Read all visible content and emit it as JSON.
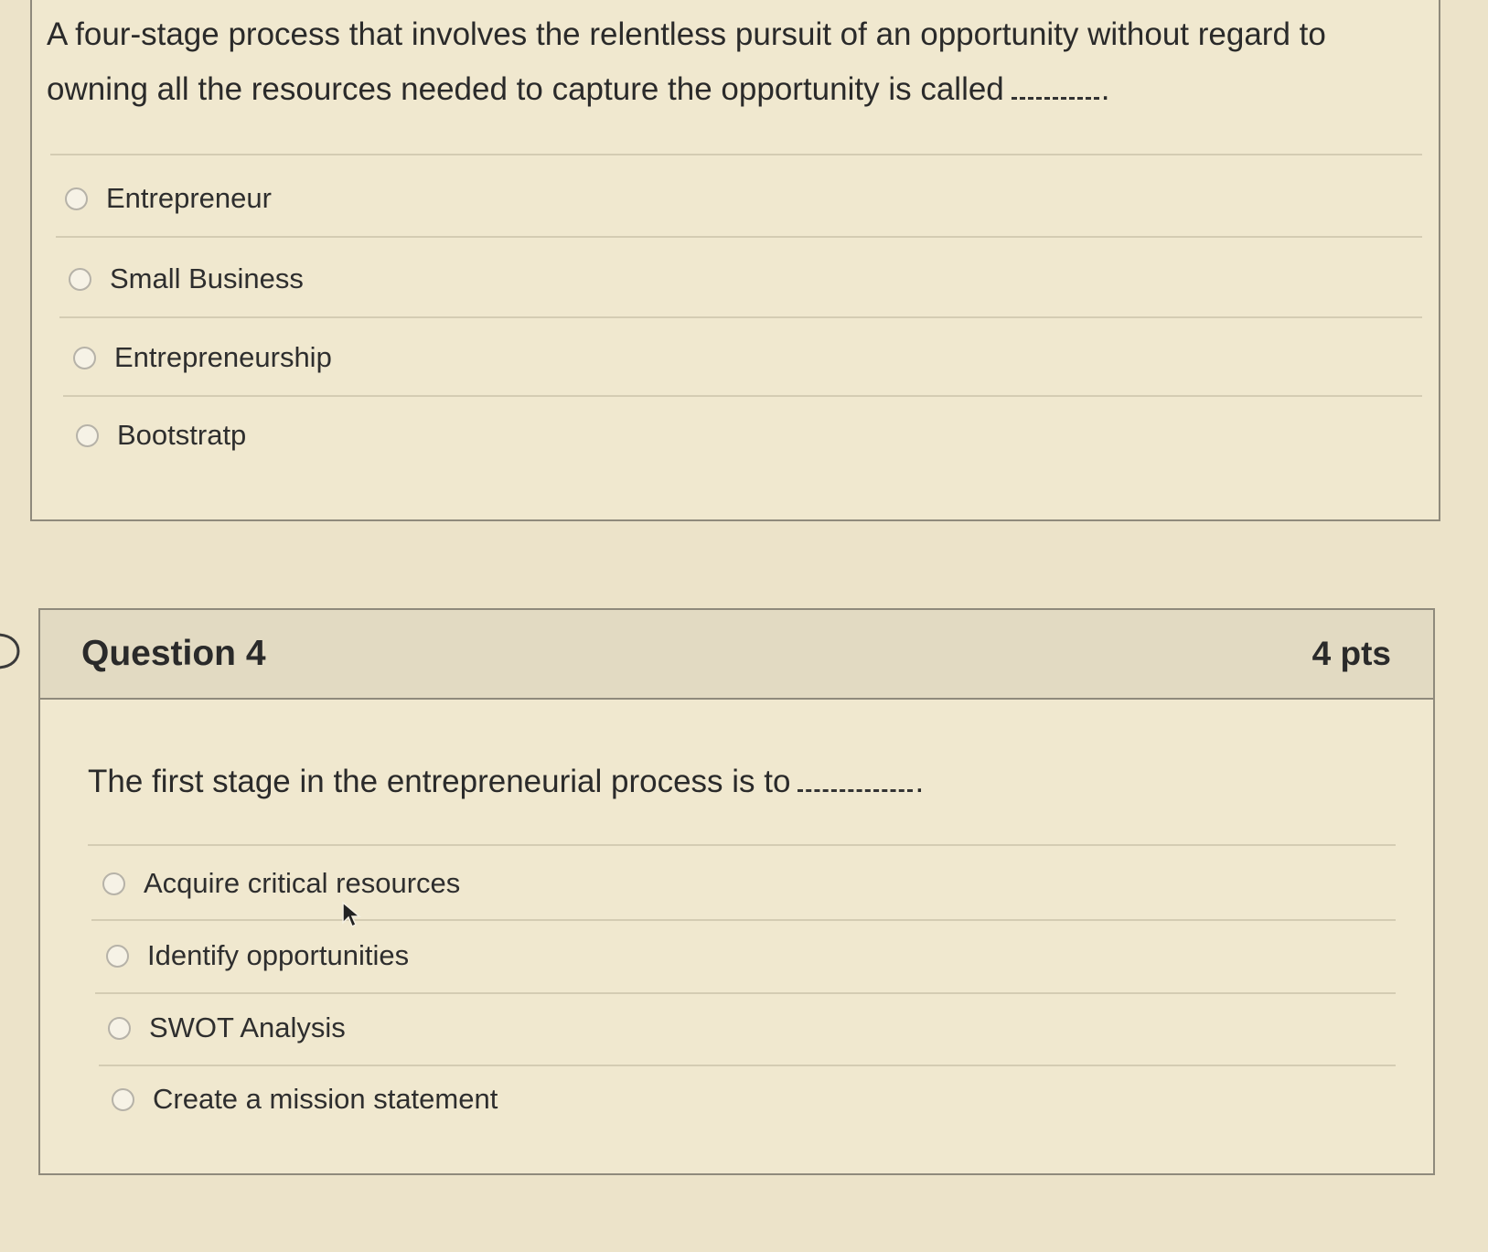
{
  "question3": {
    "text": "A four-stage process that involves the relentless pursuit of an opportunity without regard to owning all the resources needed to capture the opportunity is called",
    "answers": [
      "Entrepreneur",
      "Small Business",
      "Entrepreneurship",
      "Bootstratp"
    ]
  },
  "question4": {
    "title": "Question 4",
    "points": "4 pts",
    "text": "The first stage in the entrepreneurial process is to",
    "answers": [
      "Acquire critical resources",
      "Identify opportunities",
      "SWOT Analysis",
      "Create a mission statement"
    ]
  },
  "icons": {
    "chevron": "chevron-right-icon",
    "cursor": "mouse-cursor-icon",
    "radio": "radio-button-icon"
  },
  "colors": {
    "background": "#ece3c9",
    "border": "#8f8a7c",
    "header": "#e2dac2"
  }
}
